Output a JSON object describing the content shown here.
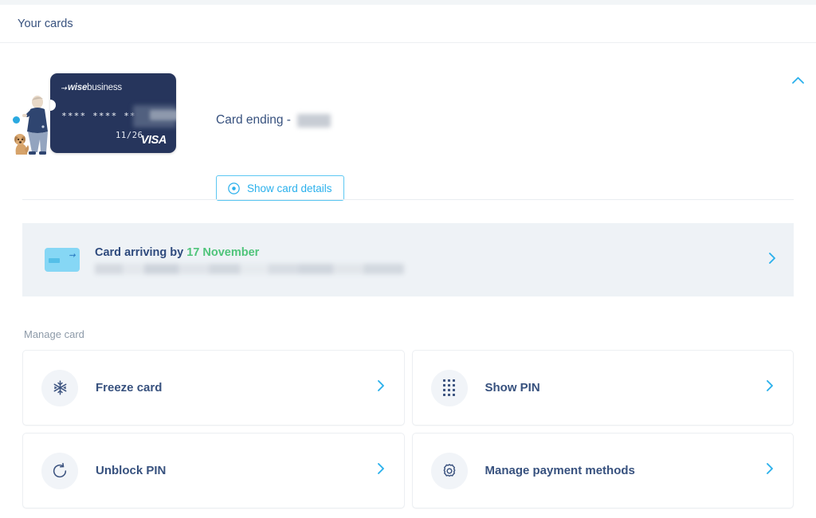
{
  "header": {
    "title": "Your cards",
    "collapse_icon": "chevron-up-icon"
  },
  "card_section": {
    "illustration": "person-with-dog-illustration",
    "card": {
      "brand_prefix": "wise",
      "brand_suffix": "business",
      "number_masked": "**** **** ****",
      "expiry": "11/26",
      "network": "VISA",
      "redacted": "last-four-digits-redacted"
    },
    "card_ending_label": "Card ending - ",
    "card_ending_value_redacted": "redacted",
    "show_details_button": {
      "label": "Show card details",
      "icon": "eye-icon"
    }
  },
  "arriving_banner": {
    "icon": "mini-card-icon",
    "title_prefix": "Card arriving by ",
    "date": "17 November",
    "subtitle_redacted": "redacted-address-line",
    "chevron_icon": "chevron-right-icon"
  },
  "manage": {
    "section_label": "Manage card",
    "tiles": [
      {
        "label": "Freeze card",
        "icon": "snowflake-icon",
        "chevron": "chevron-right-icon"
      },
      {
        "label": "Show PIN",
        "icon": "keypad-dots-icon",
        "chevron": "chevron-right-icon"
      },
      {
        "label": "Unblock PIN",
        "icon": "refresh-icon",
        "chevron": "chevron-right-icon"
      },
      {
        "label": "Manage payment methods",
        "icon": "gear-icon",
        "chevron": "chevron-right-icon"
      }
    ]
  },
  "colors": {
    "navy_text": "#37517e",
    "accent_blue": "#2ab0ec",
    "green": "#4fc47a",
    "card_navy": "#26355c",
    "banner_bg": "#eef2f6",
    "muted_text": "#8d9aa8"
  }
}
